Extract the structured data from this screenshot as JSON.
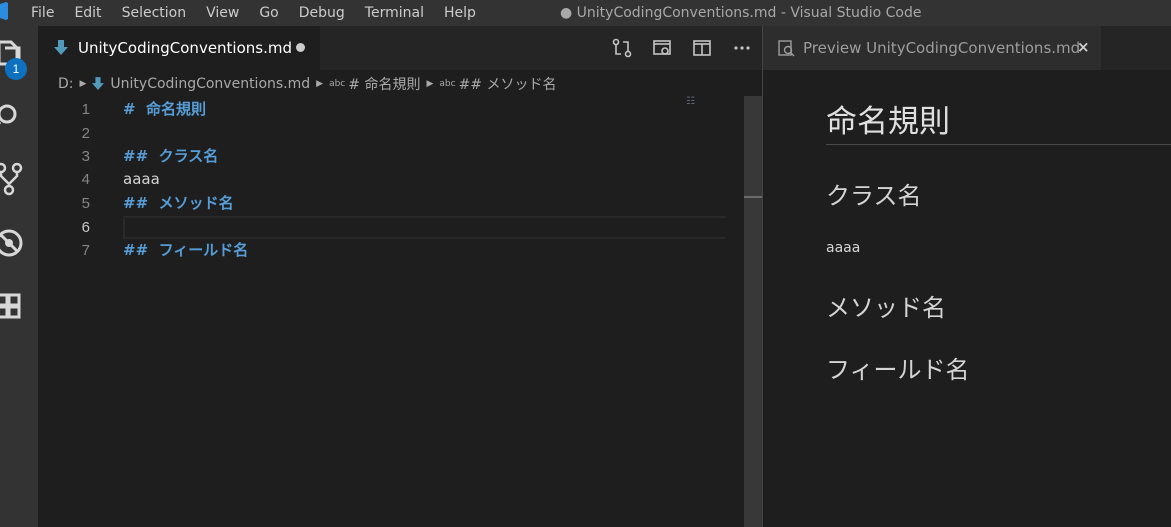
{
  "menu": [
    "File",
    "Edit",
    "Selection",
    "View",
    "Go",
    "Debug",
    "Terminal",
    "Help"
  ],
  "window_title": "● UnityCodingConventions.md - Visual Studio Code",
  "activity_bar": {
    "badge": "1"
  },
  "editor": {
    "tab_label": "UnityCodingConventions.md",
    "breadcrumb": {
      "drive": "D:",
      "file": "UnityCodingConventions.md",
      "abc1": "abc",
      "section1": "# 命名規則",
      "abc2": "abc",
      "section2": "## メソッド名"
    },
    "lines": [
      {
        "n": "1",
        "text": "#  命名規則"
      },
      {
        "n": "2",
        "text": ""
      },
      {
        "n": "3",
        "text": "##  クラス名"
      },
      {
        "n": "4",
        "text": "aaaa"
      },
      {
        "n": "5",
        "text": "##  メソッド名"
      },
      {
        "n": "6",
        "text": ""
      },
      {
        "n": "7",
        "text": "##  フィールド名"
      }
    ]
  },
  "preview": {
    "tab_label": "Preview UnityCodingConventions.md",
    "close": "×",
    "h1": "命名規則",
    "h2_class": "クラス名",
    "paragraph": "aaaa",
    "h2_method": "メソッド名",
    "h2_field": "フィールド名"
  },
  "colors": {
    "heading": "#569cd6",
    "badge": "#0e70c0",
    "md_icon": "#519aba"
  }
}
